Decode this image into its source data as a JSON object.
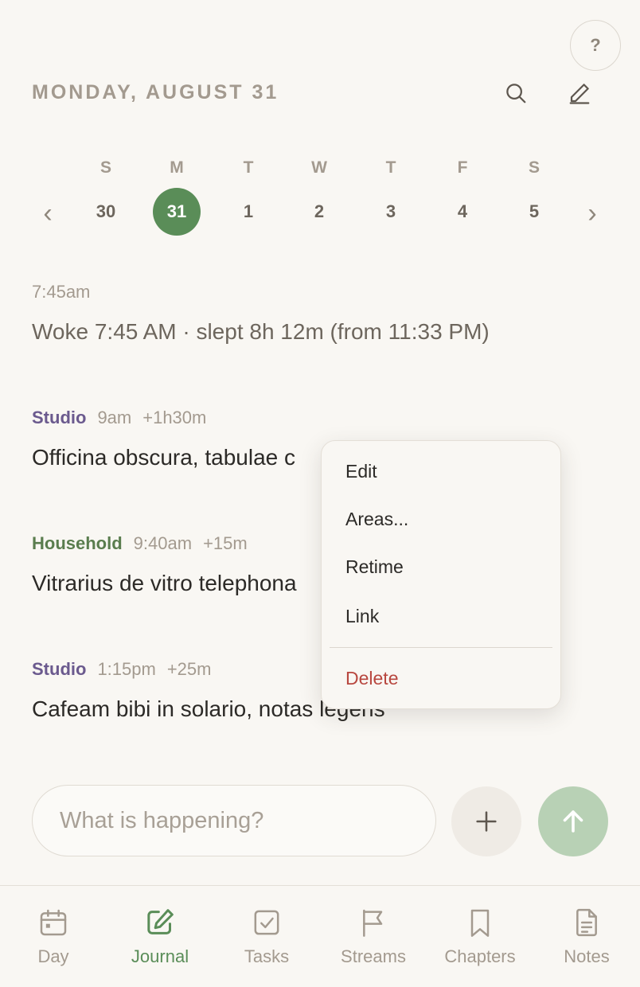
{
  "header": {
    "help_label": "?",
    "date_title": "MONDAY, AUGUST 31"
  },
  "week": {
    "letters": [
      "S",
      "M",
      "T",
      "W",
      "T",
      "F",
      "S"
    ],
    "days": [
      "30",
      "31",
      "1",
      "2",
      "3",
      "4",
      "5"
    ],
    "selected_index": 1,
    "prev_label": "‹",
    "next_label": "›"
  },
  "entries": [
    {
      "time": "7:45am",
      "text": "Woke 7:45 AM · slept 8h 12m (from 11:33 PM)"
    },
    {
      "area": "Studio",
      "area_color": "#6b5a8e",
      "time": "9am",
      "duration": "+1h30m",
      "text": "Officina obscura, tabulae c"
    },
    {
      "area": "Household",
      "area_color": "#5a7d4e",
      "time": "9:40am",
      "duration": "+15m",
      "text": "Vitrarius de vitro telephona"
    },
    {
      "area": "Studio",
      "area_color": "#6b5a8e",
      "time": "1:15pm",
      "duration": "+25m",
      "text": "Cafeam bibi in solario, notas legens"
    }
  ],
  "context_menu": {
    "items": [
      "Edit",
      "Areas...",
      "Retime",
      "Link"
    ],
    "danger_item": "Delete",
    "danger_color": "#b8473f"
  },
  "composer": {
    "placeholder": "What is happening?"
  },
  "tabs": [
    {
      "label": "Day",
      "icon": "calendar-icon"
    },
    {
      "label": "Journal",
      "icon": "pencil-square-icon"
    },
    {
      "label": "Tasks",
      "icon": "checkbox-icon"
    },
    {
      "label": "Streams",
      "icon": "flag-icon"
    },
    {
      "label": "Chapters",
      "icon": "bookmark-icon"
    },
    {
      "label": "Notes",
      "icon": "document-icon"
    }
  ],
  "active_tab": "Journal",
  "colors": {
    "accent_green": "#5a8d58",
    "send_green_light": "#b8d1b5",
    "muted_text": "#a39a8f",
    "background": "#f9f7f3"
  }
}
